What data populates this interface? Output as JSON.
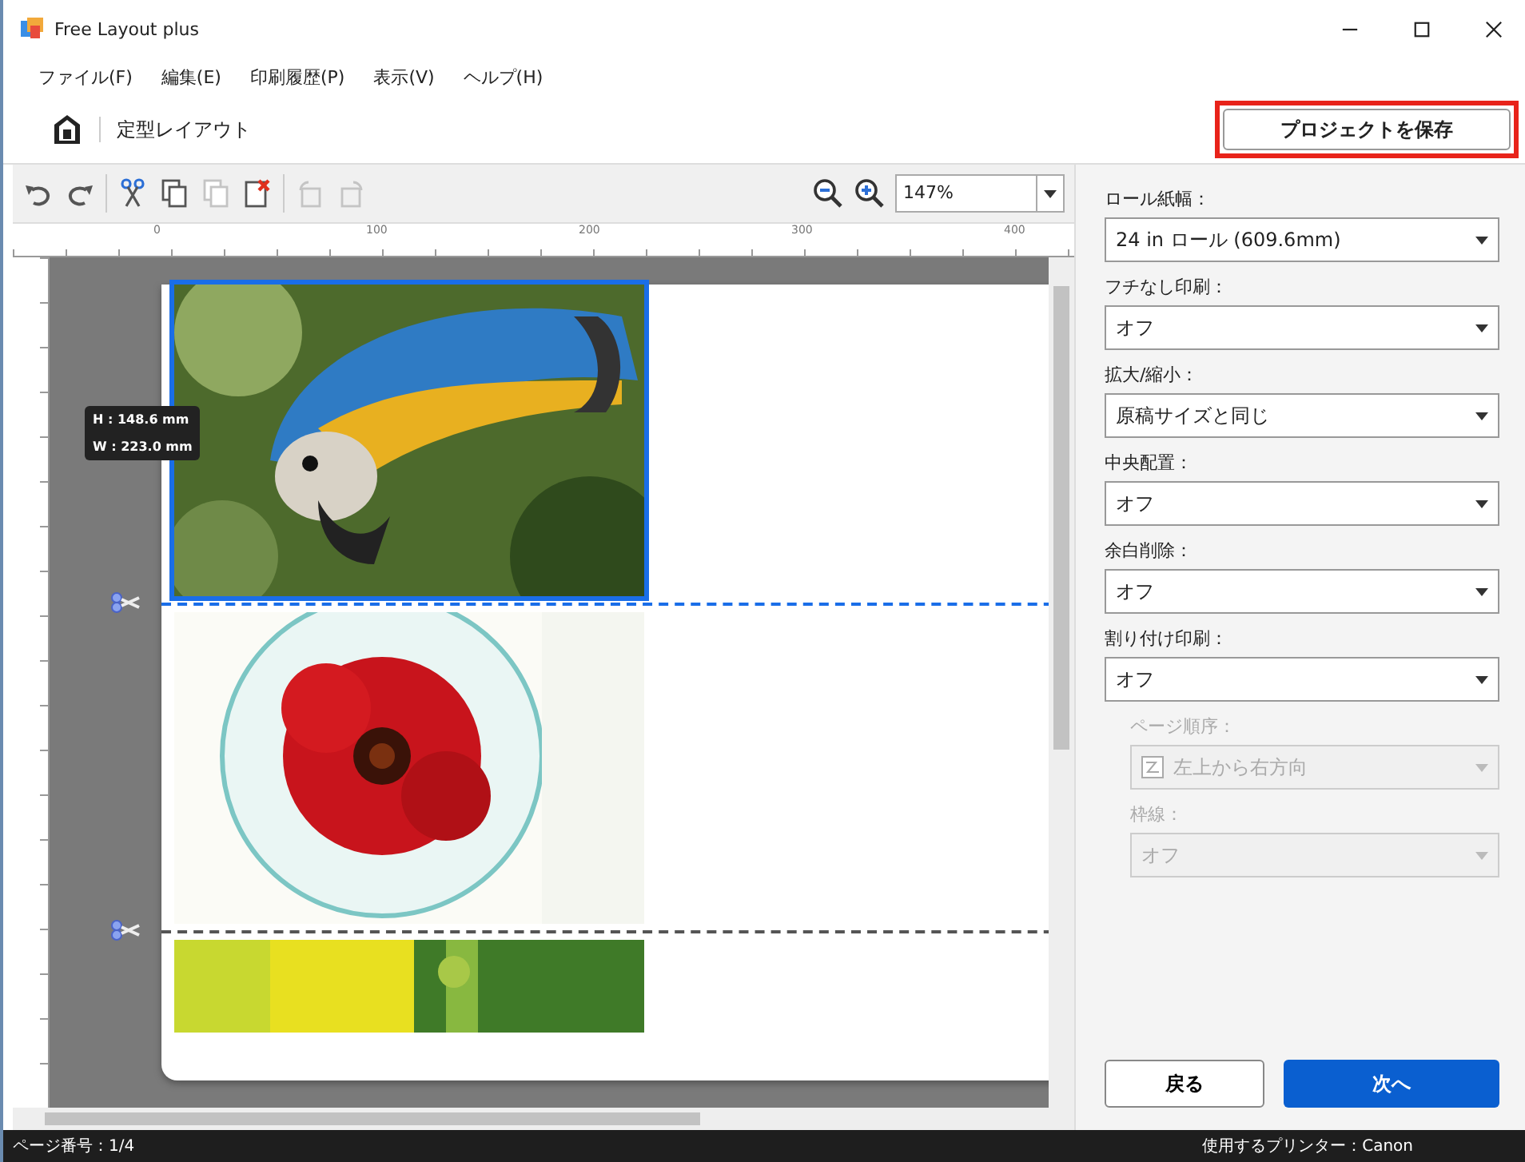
{
  "window": {
    "title": "Free Layout plus"
  },
  "menu": [
    "ファイル(F)",
    "編集(E)",
    "印刷履歴(P)",
    "表示(V)",
    "ヘルプ(H)"
  ],
  "breadcrumb": "定型レイアウト",
  "save_button": "プロジェクトを保存",
  "toolbar": [
    {
      "kind": "undo",
      "disabled": false
    },
    {
      "kind": "redo",
      "disabled": false
    },
    {
      "kind": "cut",
      "disabled": false
    },
    {
      "kind": "copy",
      "disabled": false
    },
    {
      "kind": "paste",
      "disabled": true
    },
    {
      "kind": "delete",
      "disabled": false
    },
    {
      "kind": "rotate-left",
      "disabled": true
    },
    {
      "kind": "rotate-right",
      "disabled": true
    }
  ],
  "zoom": {
    "value": "147%"
  },
  "ruler": {
    "labels": [
      "0",
      "100",
      "200",
      "300",
      "400"
    ]
  },
  "size_tooltip": [
    "H : 148.6 mm",
    "W : 223.0 mm"
  ],
  "images": [
    {
      "kind": "picture",
      "selected": true
    },
    {
      "kind": "picture",
      "selected": false
    },
    {
      "kind": "picture",
      "selected": false
    }
  ],
  "settings": [
    {
      "label": "ロール紙幅：",
      "value": "24 in ロール (609.6mm)",
      "disabled": false
    },
    {
      "label": "フチなし印刷：",
      "value": "オフ",
      "disabled": false
    },
    {
      "label": "拡大/縮小：",
      "value": "原稿サイズと同じ",
      "disabled": false
    },
    {
      "label": "中央配置：",
      "value": "オフ",
      "disabled": false
    },
    {
      "label": "余白削除：",
      "value": "オフ",
      "disabled": false
    },
    {
      "label": "割り付け印刷：",
      "value": "オフ",
      "disabled": false,
      "children": [
        {
          "label": "ページ順序：",
          "value": "左上から右方向",
          "disabled": true,
          "kind": "icon"
        },
        {
          "label": "枠線：",
          "value": "オフ",
          "disabled": true
        }
      ]
    }
  ],
  "buttons": {
    "back": "戻る",
    "next": "次へ"
  },
  "status_bar": {
    "page": "ページ番号：1/4",
    "printer": "使用するプリンター：Canon"
  }
}
